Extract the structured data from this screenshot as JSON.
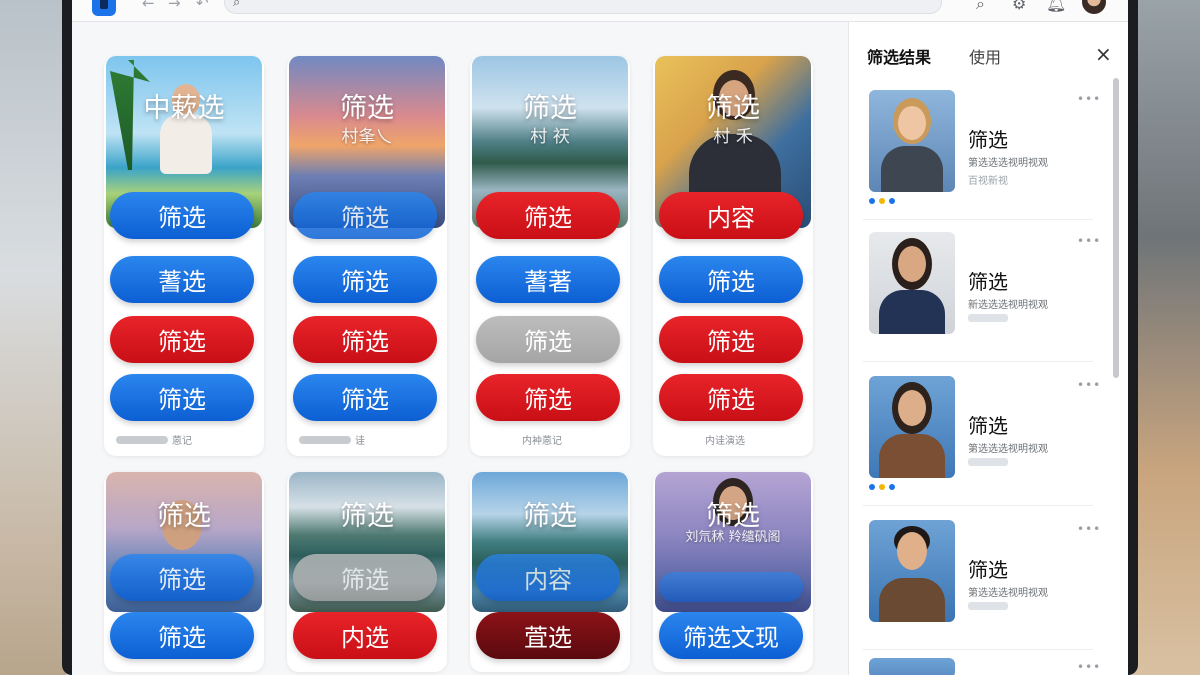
{
  "topbar": {
    "nav_back": "←",
    "nav_forward": "→",
    "nav_history": "↶",
    "search_icon": "⌕",
    "icons": [
      "search-icon",
      "settings-icon",
      "bell-icon",
      "avatar"
    ]
  },
  "grid": {
    "row1": [
      {
        "thumb_title": "中蔌选",
        "thumb_sub": "",
        "pills": [
          {
            "label": "筛选",
            "color": "blue"
          },
          {
            "label": "蓍选",
            "color": "blue"
          },
          {
            "label": "筛选",
            "color": "red"
          },
          {
            "label": "筛选",
            "color": "blue"
          }
        ],
        "foot": "蒽记"
      },
      {
        "thumb_title": "筛选",
        "thumb_sub": "村夆乀",
        "pills": [
          {
            "label": "筛选",
            "color": "blue"
          },
          {
            "label": "筛选",
            "color": "blue"
          },
          {
            "label": "筛选",
            "color": "red"
          },
          {
            "label": "筛选",
            "color": "blue"
          }
        ],
        "foot": "诖"
      },
      {
        "thumb_title": "筛选",
        "thumb_sub": "村 祆",
        "pills": [
          {
            "label": "筛选",
            "color": "red"
          },
          {
            "label": "蓍著",
            "color": "blue"
          },
          {
            "label": "筛选",
            "color": "gray"
          },
          {
            "label": "筛选",
            "color": "red"
          }
        ],
        "foot": "内衶蒽记"
      },
      {
        "thumb_title": "筛选",
        "thumb_sub": "村 禾",
        "pills": [
          {
            "label": "内容",
            "color": "red"
          },
          {
            "label": "筛选",
            "color": "blue"
          },
          {
            "label": "筛选",
            "color": "red"
          },
          {
            "label": "筛选",
            "color": "red"
          }
        ],
        "foot": "内诖演选"
      }
    ],
    "row2": [
      {
        "thumb_title": "筛选",
        "pills": [
          {
            "label": "筛选",
            "color": "blue"
          },
          {
            "label": "筛选",
            "color": "blue"
          }
        ]
      },
      {
        "thumb_title": "筛选",
        "pills": [
          {
            "label": "筛选",
            "color": "gray"
          },
          {
            "label": "内选",
            "color": "red"
          }
        ]
      },
      {
        "thumb_title": "筛选",
        "pills": [
          {
            "label": "内容",
            "color": "blue"
          },
          {
            "label": "萓选",
            "color": "red"
          }
        ]
      },
      {
        "thumb_title": "筛选",
        "thumb_sub": "刘氘秫 羚缱矾阁",
        "pills": [
          {
            "label": "",
            "color": "blue"
          },
          {
            "label": "筛选文现",
            "color": "blue"
          }
        ]
      }
    ]
  },
  "panel": {
    "tab_active": "筛选结果",
    "tab_other": "使用",
    "close": "×",
    "more": "•••",
    "results": [
      {
        "title": "筛选",
        "subtitle": "第选选选视明视观",
        "meta": "百视新视"
      },
      {
        "title": "筛选",
        "subtitle": "新选选选视明视观",
        "meta": ""
      },
      {
        "title": "筛选",
        "subtitle": "第选选选视明视观",
        "meta": ""
      },
      {
        "title": "筛选",
        "subtitle": "第选选选视明视观",
        "meta": ""
      }
    ]
  },
  "colors": {
    "blue": "#0c5fd3",
    "red": "#d0141a",
    "gray": "#adadad"
  }
}
